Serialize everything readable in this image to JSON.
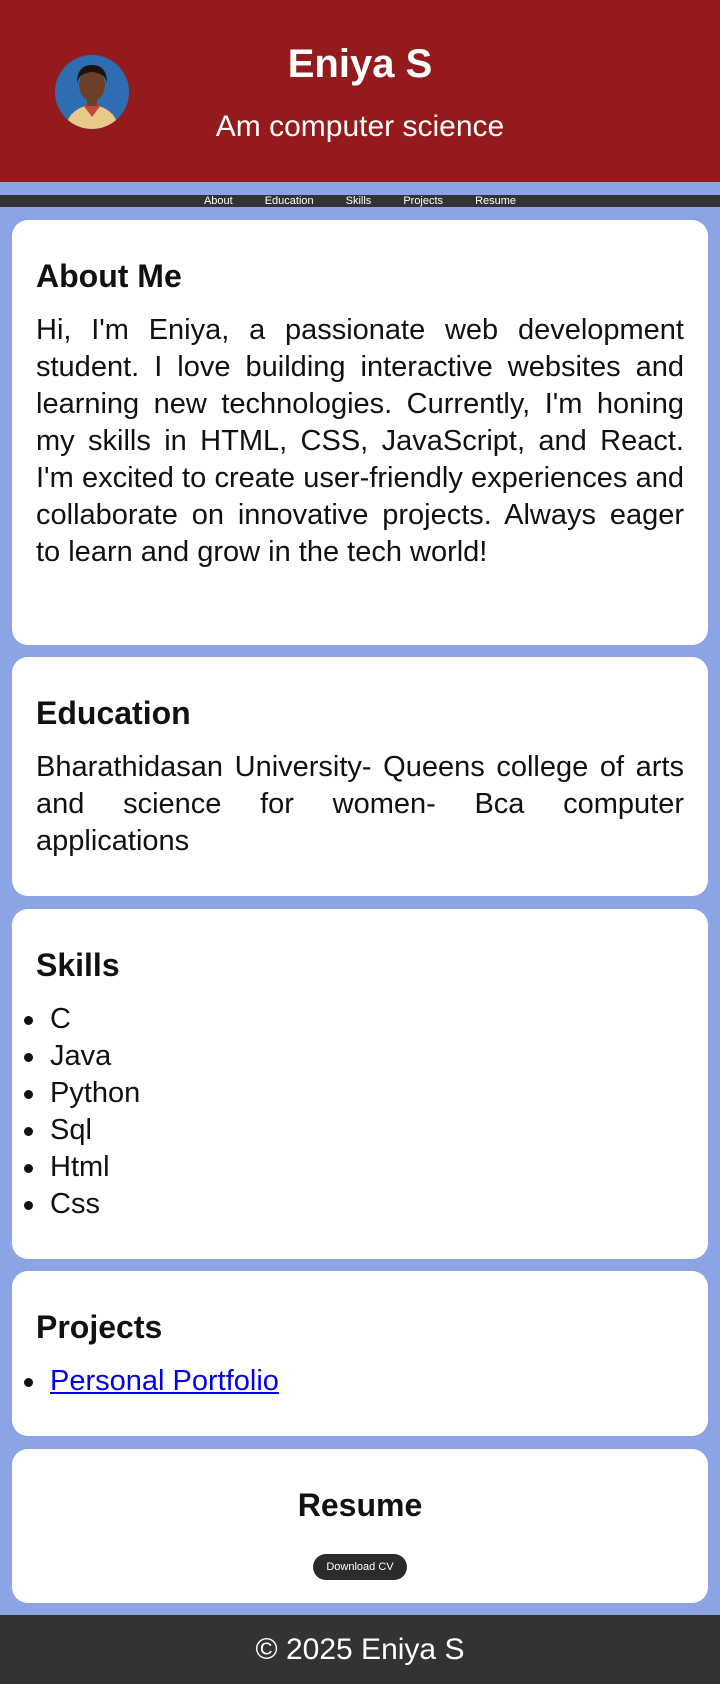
{
  "header": {
    "name": "Eniya S",
    "tagline": "Am computer science"
  },
  "nav": {
    "items": [
      "About",
      "Education",
      "Skills",
      "Projects",
      "Resume"
    ]
  },
  "about": {
    "title": "About Me",
    "text": "Hi, I'm Eniya, a passionate web development student. I love building interactive websites and learning new technologies. Currently, I'm honing my skills in HTML, CSS, JavaScript, and React. I'm excited to create user-friendly experiences and collaborate on innovative projects. Always eager to learn and grow in the tech world!"
  },
  "education": {
    "title": "Education",
    "text": "Bharathidasan University- Queens college of arts and science for women- Bca computer applications"
  },
  "skills": {
    "title": "Skills",
    "items": [
      "C",
      "Java",
      "Python",
      "Sql",
      "Html",
      "Css"
    ]
  },
  "projects": {
    "title": "Projects",
    "items": [
      "Personal Portfolio"
    ]
  },
  "resume": {
    "title": "Resume",
    "button_label": "Download CV"
  },
  "footer": {
    "text": "© 2025 Eniya S"
  },
  "colors": {
    "header_bg": "#941a1b",
    "page_bg": "#8aa4e6",
    "nav_bg": "#333333",
    "link": "#0000ee"
  }
}
